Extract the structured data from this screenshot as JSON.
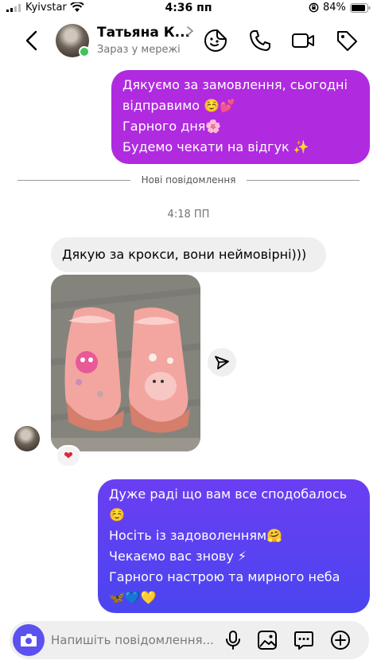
{
  "status_bar": {
    "carrier": "Kyivstar",
    "time": "4:36 пп",
    "battery": "84%"
  },
  "header": {
    "contact_name": "Татьяна К...",
    "status": "Зараз у мережі",
    "icons": [
      "back-icon",
      "sticker-icon",
      "phone-icon",
      "video-icon",
      "tag-icon"
    ]
  },
  "messages": {
    "outgoing_1": [
      "Дякуємо за замовлення, сьогодні",
      "відправимо ☺️💕",
      "Гарного дня🌸",
      "Будемо чекати на відгук ✨"
    ],
    "new_messages_divider": "Нові повідомлення",
    "timestamp": "4:18 ПП",
    "incoming_1": "Дякую за крокси, вони неймовірні)))",
    "photo_reaction": "❤",
    "outgoing_2": [
      "Дуже раді що вам все сподобалось",
      "☺️",
      "Носіть із задоволенням🤗",
      "Чекаємо вас знову ⚡",
      "Гарного настрою та мирного неба",
      "🦋💙💛"
    ]
  },
  "composer": {
    "placeholder": "Напишіть повідомлення...",
    "icons": [
      "camera-icon",
      "microphone-icon",
      "gallery-icon",
      "sticker-chat-icon",
      "add-icon"
    ]
  },
  "colors": {
    "outgoing_1_bg": "#b02ae0",
    "outgoing_2_bg": "#5b46f0",
    "incoming_bg": "#efefef",
    "online": "#3fc35b",
    "camera_button": "#5b51f0"
  }
}
